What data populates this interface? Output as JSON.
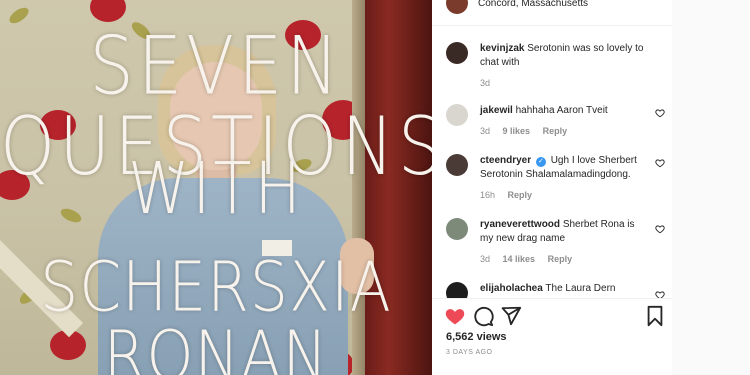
{
  "post": {
    "location": "Concord, Massachusetts",
    "overlay_lines": [
      "SEVEN QUESTIONS",
      "WITH",
      "SCHERSXIA RONAN"
    ]
  },
  "comments": [
    {
      "username": "kevinjzak",
      "text": "Serotonin was so lovely to chat with",
      "time": "3d",
      "likes": "",
      "reply": "",
      "verified": false,
      "avatar_color": "#3a2a26"
    },
    {
      "username": "jakewil",
      "text": "hahhaha Aaron Tveit",
      "time": "3d",
      "likes": "9 likes",
      "reply": "Reply",
      "verified": false,
      "avatar_color": "#d9d6cf"
    },
    {
      "username": "cteendryer",
      "text": "Ugh I love Sherbert Serotonin Shalamalamadingdong.",
      "time": "16h",
      "likes": "",
      "reply": "Reply",
      "verified": true,
      "avatar_color": "#4a3b36"
    },
    {
      "username": "ryaneverettwood",
      "text": "Sherbet Rona is my new drag name",
      "time": "3d",
      "likes": "14 likes",
      "reply": "Reply",
      "verified": false,
      "avatar_color": "#7d8a7a"
    },
    {
      "username": "elijaholachea",
      "text": "The Laura Dern",
      "time": "",
      "likes": "",
      "reply": "",
      "verified": false,
      "avatar_color": "#1d1d1d"
    }
  ],
  "actions": {
    "views": "6,562 views",
    "time_ago": "3 DAYS AGO",
    "like_color": "#ed4956",
    "icons": [
      "heart-icon",
      "comment-icon",
      "share-icon",
      "bookmark-icon"
    ]
  }
}
